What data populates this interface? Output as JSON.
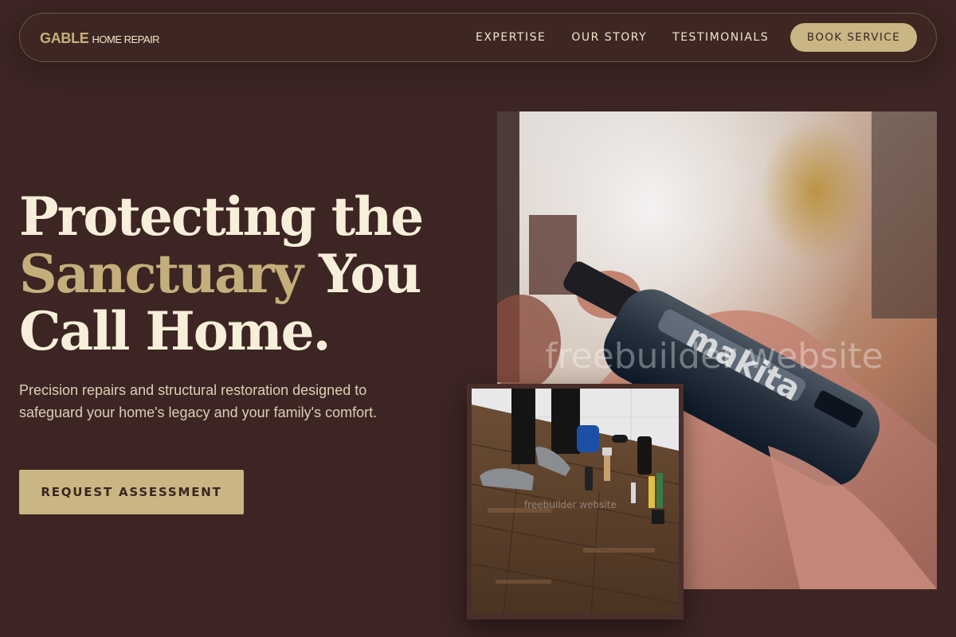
{
  "nav": {
    "brand_main": "GABLE",
    "brand_sub": "HOME REPAIR",
    "links": [
      "EXPERTISE",
      "OUR STORY",
      "TESTIMONIALS"
    ],
    "cta": "BOOK SERVICE"
  },
  "hero": {
    "title_line1": "Protecting the",
    "title_accent": "Sanctuary",
    "title_line2_rest": " You",
    "title_line3": "Call Home.",
    "description": "Precision repairs and structural restoration designed to safeguard your home's legacy and your family's comfort.",
    "cta": "REQUEST ASSESSMENT"
  },
  "images": {
    "main_watermark": "freebuilder website",
    "main_drill_brand": "makita",
    "small_watermark": "freebuilder website"
  },
  "colors": {
    "background": "#3c2522",
    "accent": "#c9b684",
    "heading": "#f7efd9"
  }
}
